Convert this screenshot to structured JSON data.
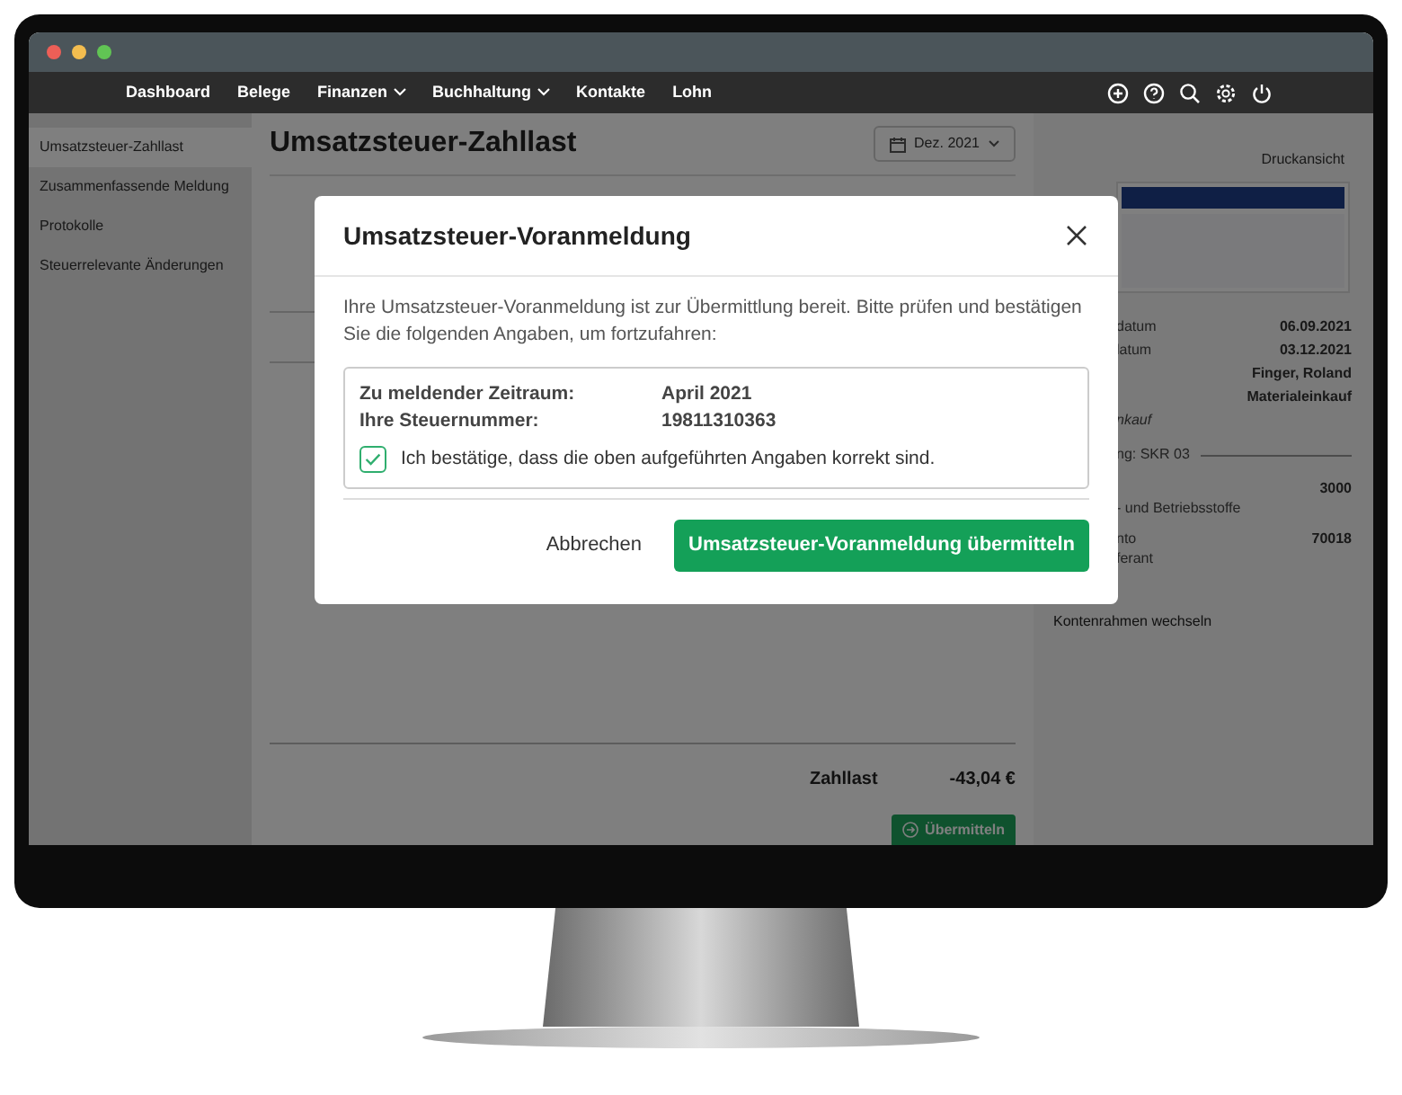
{
  "nav": {
    "items": [
      {
        "label": "Dashboard",
        "dropdown": false
      },
      {
        "label": "Belege",
        "dropdown": false
      },
      {
        "label": "Finanzen",
        "dropdown": true
      },
      {
        "label": "Buchhaltung",
        "dropdown": true
      },
      {
        "label": "Kontakte",
        "dropdown": false
      },
      {
        "label": "Lohn",
        "dropdown": false
      }
    ]
  },
  "sidebar": {
    "items": [
      {
        "label": "Umsatzsteuer-Zahllast",
        "selected": true
      },
      {
        "label": "Zusammenfassende Meldung",
        "selected": false
      },
      {
        "label": "Protokolle",
        "selected": false
      },
      {
        "label": "Steuerrelevante Änderungen",
        "selected": false
      }
    ]
  },
  "page": {
    "title": "Umsatzsteuer-Zahllast",
    "period": "Dez. 2021",
    "print_view": "Druckansicht"
  },
  "summary": {
    "label": "Zahllast",
    "amount": "-43,04 €",
    "submit": "Übermitteln"
  },
  "details_panel": {
    "rows": [
      {
        "kind": "pair",
        "label": "datum",
        "value": "06.09.2021"
      },
      {
        "kind": "pair",
        "label": "latum",
        "value": "03.12.2021"
      },
      {
        "kind": "pair",
        "value": "Finger, Roland"
      },
      {
        "kind": "pair",
        "value": "Materialeinkauf"
      },
      {
        "kind": "note",
        "label": "nkauf"
      },
      {
        "kind": "section",
        "label": "ng: SKR 03"
      },
      {
        "kind": "account",
        "value": "3000",
        "sublabel": "- und Betriebsstoffe"
      },
      {
        "kind": "account",
        "label": "nto",
        "value": "70018",
        "sublabel": "ferant"
      }
    ],
    "link": "Kontenrahmen wechseln"
  },
  "modal": {
    "title": "Umsatzsteuer-Voranmeldung",
    "message": "Ihre Umsatzsteuer-Voranmeldung ist zur Übermittlung bereit. Bitte prüfen und bestätigen Sie die folgenden Angaben, um fortzufahren:",
    "fields": [
      {
        "label": "Zu meldender Zeitraum:",
        "value": "April 2021"
      },
      {
        "label": "Ihre Steuernummer:",
        "value": "19811310363"
      }
    ],
    "confirm": {
      "label": "Ich bestätige, dass die oben aufgeführten Angaben korrekt sind.",
      "checked": true
    },
    "cancel": "Abbrechen",
    "submit": "Umsatzsteuer-Voranmeldung übermitteln"
  }
}
